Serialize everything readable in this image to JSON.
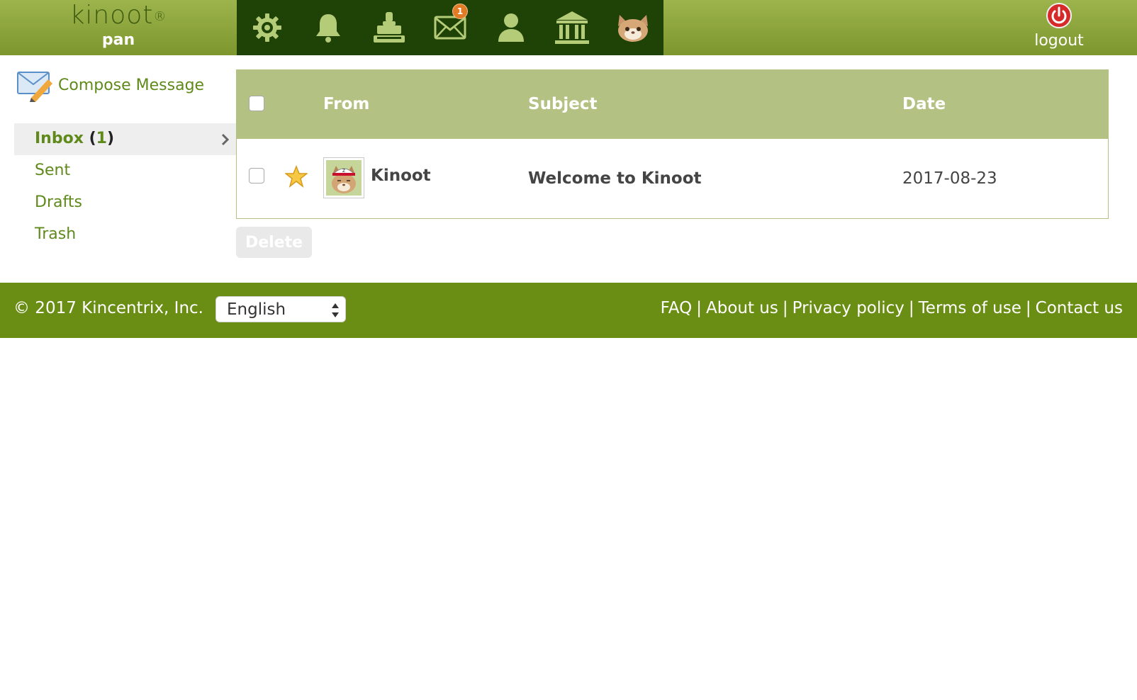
{
  "header": {
    "logo_text": "kinoot",
    "logo_mark": "®",
    "username": "pan",
    "nav_icons": [
      {
        "name": "gear-icon"
      },
      {
        "name": "bell-icon"
      },
      {
        "name": "stamp-icon"
      },
      {
        "name": "mail-icon",
        "badge": "1"
      },
      {
        "name": "person-icon"
      },
      {
        "name": "bank-icon"
      },
      {
        "name": "cat-face-icon"
      }
    ],
    "logout_label": "logout"
  },
  "sidebar": {
    "compose_label": "Compose Message",
    "folders": [
      {
        "label": "Inbox",
        "count": "1",
        "active": true
      },
      {
        "label": "Sent"
      },
      {
        "label": "Drafts"
      },
      {
        "label": "Trash"
      }
    ]
  },
  "table": {
    "columns": {
      "from": "From",
      "subject": "Subject",
      "date": "Date"
    },
    "rows": [
      {
        "from": "Kinoot",
        "subject": "Welcome to Kinoot",
        "date": "2017-08-23",
        "starred": true
      }
    ],
    "delete_label": "Delete"
  },
  "footer": {
    "copyright": "© 2017 Kincentrix, Inc.",
    "language": "English",
    "links": [
      "FAQ",
      "About us",
      "Privacy policy",
      "Terms of use",
      "Contact us"
    ],
    "separator": "|"
  },
  "colors": {
    "header_green": "#8ca53c",
    "icon_bar": "#1f4306",
    "footer_green": "#6a8d14",
    "table_header": "#b3c283",
    "link_green": "#5f8a1b",
    "badge_orange": "#e07b26",
    "logout_red": "#d62a2a"
  }
}
